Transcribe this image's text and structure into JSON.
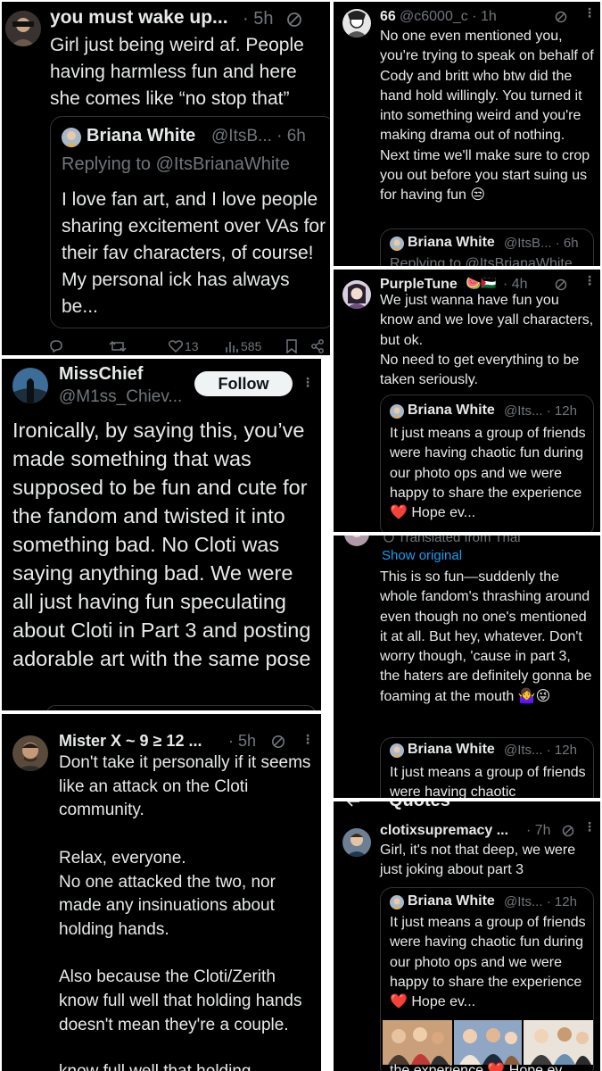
{
  "p1": {
    "name": "you must wake up...",
    "time": "· 5h",
    "body": "Girl just being weird af. People having harmless fun and here she comes like “no stop that”",
    "quote": {
      "name": "Briana White",
      "handle": "@ItsB... · 6h",
      "replying": "Replying to @ItsBrianaWhite",
      "text": "I love fan art, and I love people sharing excitement over VAs for their fav characters, of course! My personal ick has always be..."
    },
    "likes": "13",
    "views": "585"
  },
  "p2": {
    "name": "66",
    "handle": "@c6000_c · 1h",
    "body": "No one even mentioned you, you're trying to speak on behalf of Cody and britt who btw did the hand hold willingly. You turned it into something weird and you're making drama out of nothing. Next time we'll make sure to crop you out before you start suing us for having fun 😒",
    "quote": {
      "name": "Briana White",
      "handle": "@ItsB... · 6h",
      "replying": "Replying to @ItsBrianaWhite"
    }
  },
  "p3": {
    "name": "PurpleTune",
    "emoji": "🍉🇵🇸",
    "time": "· 4h",
    "body": "We just wanna have fun you know and we love yall characters, but ok.\nNo need to get everything to be taken seriously.",
    "quote": {
      "name": "Briana White",
      "handle": "@Its... · 12h",
      "text": "It just means a group of friends were having chaotic fun during our photo ops and we were happy to share the experience ❤️ Hope ev..."
    }
  },
  "p4": {
    "name": "MissChief",
    "handle": "@M1ss_Chiev...",
    "follow": "Follow",
    "body": "Ironically, by saying this, you’ve made something that was supposed to be fun and cute for the fandom and twisted it into something bad. No Cloti was saying anything bad. We were all just having fun speculating about Cloti in Part 3 and posting adorable art with the same pose"
  },
  "p5": {
    "translated": "Translated from Thai",
    "show_original": "Show original",
    "body": "This is so fun—suddenly the whole fandom's thrashing around even though no one's mentioned it at all. But hey, whatever. Don't worry though, 'cause in part 3, the haters are definitely gonna be foaming at the mouth 🤷‍♀️😜",
    "quote": {
      "name": "Briana White",
      "handle": "@Its... · 12h",
      "text": "It just means a group of friends were having chaotic"
    }
  },
  "p6": {
    "name": "Mister X ~ 9 ≥ 12 ...",
    "time": "· 5h",
    "body": "Don't take it personally if it seems like an attack on the Cloti community.\n\nRelax, everyone.\nNo one attacked the two, nor made any insinuations about holding hands.\n\nAlso because the Cloti/Zerith know full well that holding hands doesn't mean they're a couple.",
    "cut": "know full well that holding"
  },
  "p7": {
    "header": "Quotes",
    "name": "clotixsupremacy ...",
    "time": "· 7h",
    "body": "Girl, it's not that deep, we were just joking about part 3",
    "quote": {
      "name": "Briana White",
      "handle": "@Its... · 12h",
      "text": "It just means a group of friends were having chaotic fun during our photo ops and we were happy to share the experience ❤️ Hope ev...",
      "cut": "the experience ❤️ Hope ev..."
    }
  },
  "colors": {
    "bg": "#000000",
    "text": "#e7e9ea",
    "muted": "#71767b",
    "border": "#2f3336",
    "follow_bg": "#eff3f4"
  }
}
